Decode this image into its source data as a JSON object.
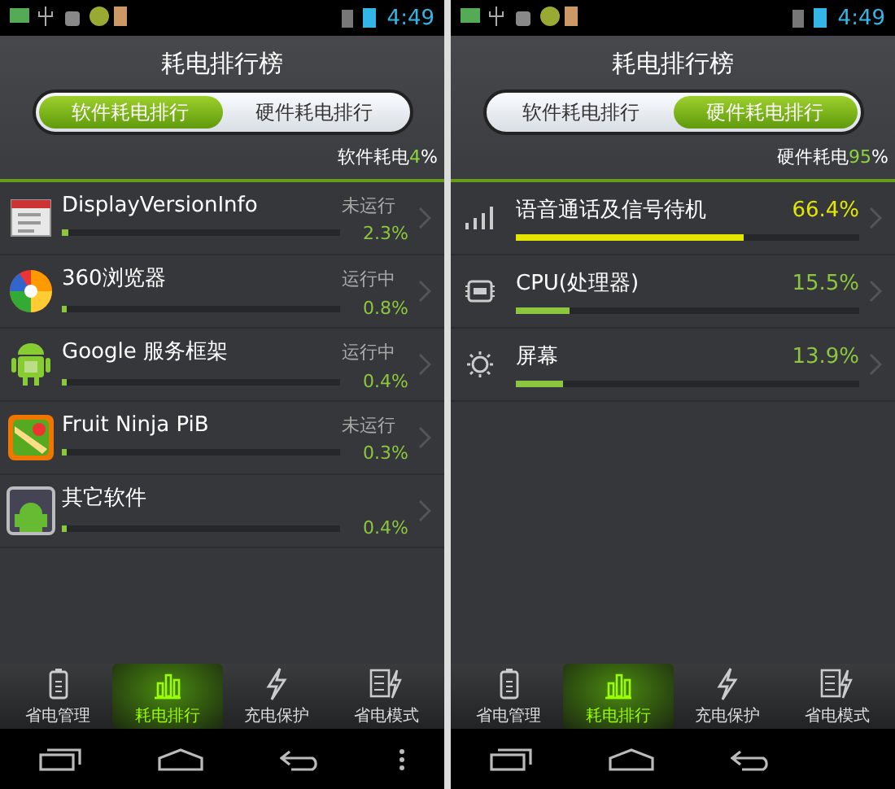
{
  "panels": [
    {
      "status_time": "4:49",
      "title": "耗电排行榜",
      "segments": [
        {
          "label": "软件耗电排行",
          "selected": true
        },
        {
          "label": "硬件耗电排行",
          "selected": false
        }
      ],
      "summary": {
        "label": "软件耗电",
        "value": "4",
        "unit": "%"
      },
      "rows": [
        {
          "kind": "app",
          "name": "DisplayVersionInfo",
          "status": "未运行",
          "percent": "2.3%",
          "level": 0.023,
          "color": "#8cc63f"
        },
        {
          "kind": "app",
          "name": "360浏览器",
          "status": "运行中",
          "percent": "0.8%",
          "level": 0.008,
          "color": "#8cc63f"
        },
        {
          "kind": "app",
          "name": "Google 服务框架",
          "status": "运行中",
          "percent": "0.4%",
          "level": 0.004,
          "color": "#8cc63f"
        },
        {
          "kind": "app",
          "name": "Fruit Ninja PiB",
          "status": "未运行",
          "percent": "0.3%",
          "level": 0.003,
          "color": "#8cc63f"
        },
        {
          "kind": "app",
          "name": "其它软件",
          "percent": "0.4%",
          "level": 0.004,
          "color": "#8cc63f"
        }
      ],
      "tabs": [
        {
          "label": "省电管理",
          "selected": false
        },
        {
          "label": "耗电排行",
          "selected": true
        },
        {
          "label": "充电保护",
          "selected": false
        },
        {
          "label": "省电模式",
          "selected": false
        }
      ]
    },
    {
      "status_time": "4:49",
      "title": "耗电排行榜",
      "segments": [
        {
          "label": "软件耗电排行",
          "selected": false
        },
        {
          "label": "硬件耗电排行",
          "selected": true
        }
      ],
      "summary": {
        "label": "硬件耗电",
        "value": "95",
        "unit": "%"
      },
      "rows": [
        {
          "kind": "component",
          "name": "语音通话及信号待机",
          "percent": "66.4%",
          "level": 0.664,
          "color": "#e3e600"
        },
        {
          "kind": "component",
          "name": "CPU(处理器)",
          "percent": "15.5%",
          "level": 0.155,
          "color": "#8cc63f"
        },
        {
          "kind": "component",
          "name": "屏幕",
          "percent": "13.9%",
          "level": 0.139,
          "color": "#8cc63f"
        }
      ],
      "tabs": [
        {
          "label": "省电管理",
          "selected": false
        },
        {
          "label": "耗电排行",
          "selected": true
        },
        {
          "label": "充电保护",
          "selected": false
        },
        {
          "label": "省电模式",
          "selected": false
        }
      ]
    }
  ]
}
